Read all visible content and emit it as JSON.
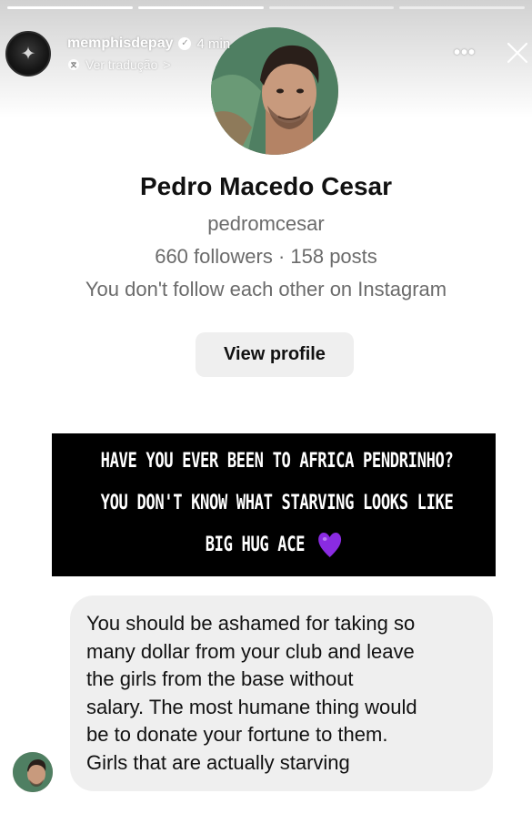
{
  "story": {
    "username": "memphisdepay",
    "time": "4 min",
    "translate_label": "Ver tradução",
    "translate_chevron": ">",
    "more_label": "•••",
    "progress_segments": 4,
    "progress_active_index": 1
  },
  "profile": {
    "name": "Pedro Macedo Cesar",
    "handle": "pedromcesar",
    "stats": "660 followers · 158 posts",
    "mutual": "You don't follow each other on Instagram",
    "view_profile_label": "View profile"
  },
  "note": {
    "line1": "Have you ever been to Africa Pendrinho?",
    "line2": "You don't know what starving looks like",
    "line3": "Big hug Ace",
    "emoji": "purple-heart"
  },
  "message": {
    "lines": [
      "You should be ashamed for taking so",
      "many dollar from your club and leave",
      "the girls from the base without",
      "salary. The most humane thing would",
      "be to donate your fortune to them.",
      "Girls that are actually starving"
    ]
  },
  "colors": {
    "bubble": "#efefef",
    "button": "#efefef",
    "note_bg": "#000000",
    "heart": "#8a2be2",
    "secondary_text": "#6b6b6b"
  }
}
